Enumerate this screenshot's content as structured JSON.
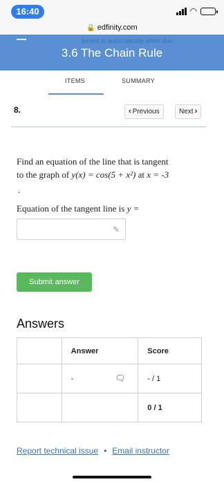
{
  "status_bar": {
    "time": "16:40",
    "signal_icon": "cellular-signal",
    "wifi_icon": "wifi",
    "battery_icon": "battery-charging",
    "battery_color": "#2fbf4a"
  },
  "browser": {
    "url": "edfinity.com",
    "lock_icon": "lock"
  },
  "header": {
    "title": "3.6 The Chain Rule",
    "overlay_text": "turned in automatically when due",
    "background": "#5b8fd3"
  },
  "tabs": [
    {
      "label": "ITEMS"
    },
    {
      "label": "SUMMARY"
    }
  ],
  "question": {
    "number": "8.",
    "prev_label": "Previous",
    "next_label": "Next",
    "prompt_line1": "Find an equation of the line that is tangent",
    "prompt_line2_prefix": "to the graph of",
    "function": "y(x) = cos(5 + x²)",
    "at_word": "at",
    "point": "x = -3",
    "dot": ".",
    "answer_label": "Equation of the tangent line is",
    "answer_var": "y =",
    "answer_value": "",
    "submit_label": "Submit answer",
    "submit_color": "#5cb85c"
  },
  "answers": {
    "heading": "Answers",
    "columns": [
      "",
      "Answer",
      "Score"
    ],
    "rows": [
      {
        "answer": "-",
        "score": "- / 1"
      },
      {
        "answer": "",
        "score": "0 / 1"
      }
    ]
  },
  "footer": {
    "report_link": "Report technical issue",
    "separator": "•",
    "email_link": "Email instructor"
  }
}
